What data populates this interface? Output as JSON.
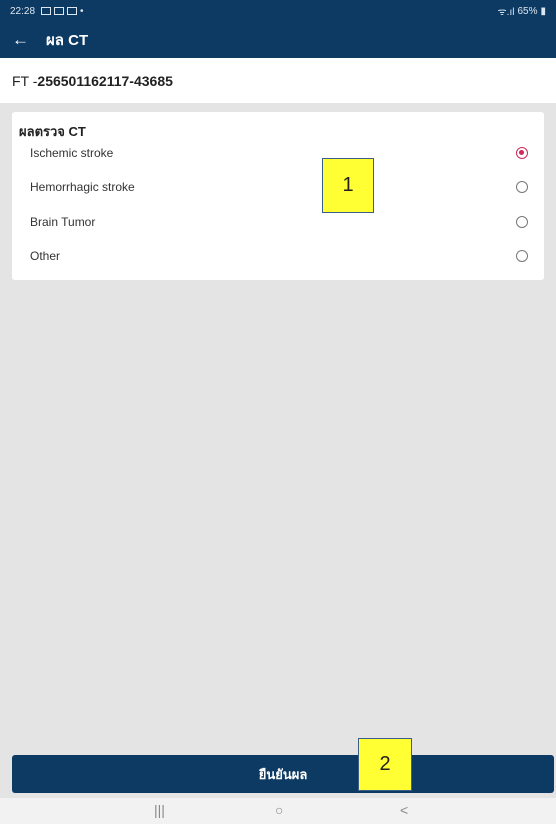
{
  "status_bar": {
    "time": "22:28",
    "battery": "65%",
    "signal_text": "ᯤ.ıl"
  },
  "app_bar": {
    "back_glyph": "←",
    "title": "ผล CT"
  },
  "record": {
    "prefix": "FT - ",
    "id": "256501162117-43685"
  },
  "ct_card": {
    "title": "ผลตรวจ CT",
    "options": [
      {
        "label": "Ischemic stroke",
        "selected": true
      },
      {
        "label": "Hemorrhagic stroke",
        "selected": false
      },
      {
        "label": "Brain Tumor",
        "selected": false
      },
      {
        "label": "Other",
        "selected": false
      }
    ]
  },
  "confirm_button_label": "ยืนยันผล",
  "nav_bar": {
    "recents": "|||",
    "home": "○",
    "back": "<"
  },
  "callouts": {
    "one": "1",
    "two": "2"
  },
  "colors": {
    "primary": "#0d3a63",
    "radio_selected": "#d02a5a",
    "background": "#e4e4e4",
    "callout": "#ffff33"
  }
}
